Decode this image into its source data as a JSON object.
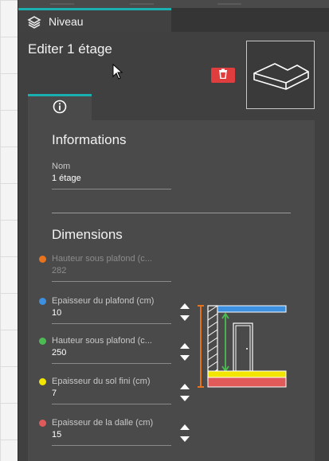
{
  "tab": {
    "label": "Niveau",
    "icon": "layers-icon"
  },
  "header": {
    "title": "Editer 1 étage",
    "delete_icon": "trash-icon"
  },
  "info_tab": {
    "icon": "info-icon"
  },
  "informations": {
    "title": "Informations",
    "nom": {
      "label": "Nom",
      "value": "1 étage"
    }
  },
  "dimensions": {
    "title": "Dimensions",
    "fields": [
      {
        "label": "Hauteur sous plafond (c...",
        "value": "282",
        "color": "#e8731e",
        "disabled": true
      },
      {
        "label": "Epaisseur du plafond (cm)",
        "value": "10",
        "color": "#3d8fe0",
        "disabled": false
      },
      {
        "label": "Hauteur sous plafond (c...",
        "value": "250",
        "color": "#4cbb52",
        "disabled": false
      },
      {
        "label": "Epaisseur du sol fini (cm)",
        "value": "7",
        "color": "#f2e600",
        "disabled": false
      },
      {
        "label": "Epaisseur de la dalle (cm)",
        "value": "15",
        "color": "#e05a5a",
        "disabled": false
      }
    ]
  },
  "colors": {
    "accent": "#1bb0b0",
    "panel": "#404040",
    "delete": "#e03e3e"
  }
}
